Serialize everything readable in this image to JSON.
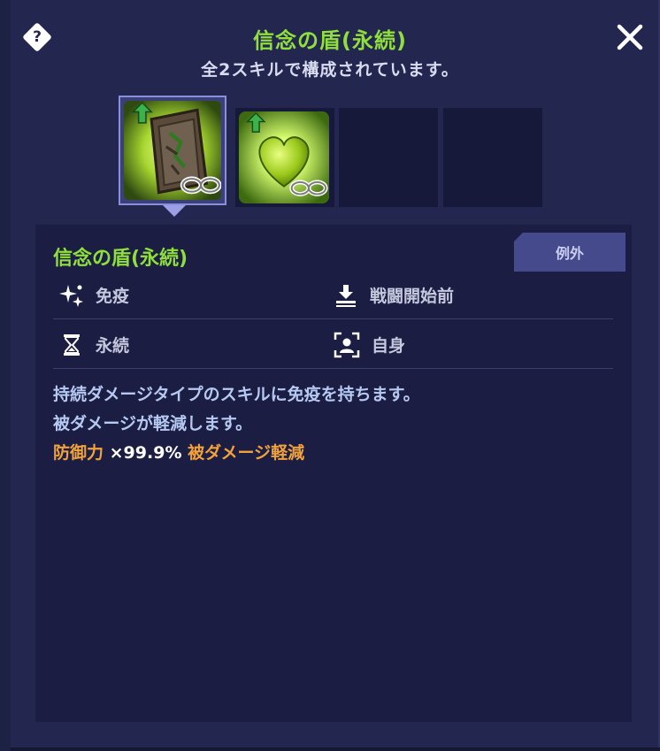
{
  "header": {
    "title": "信念の盾(永続)",
    "subtitle": "全2スキルで構成されています。",
    "help_icon": "question-diamond-icon",
    "close_icon": "close-x-icon"
  },
  "skill_slots": [
    {
      "icon": "rune-tablet-infinity-icon",
      "selected": true
    },
    {
      "icon": "green-heart-infinity-icon",
      "selected": false
    },
    {
      "icon": "empty-slot",
      "selected": false
    },
    {
      "icon": "empty-slot",
      "selected": false
    }
  ],
  "detail": {
    "name": "信念の盾(永続)",
    "tag": "例外",
    "attributes": [
      {
        "icon": "sparkle-icon",
        "label": "免疫"
      },
      {
        "icon": "download-tray-icon",
        "label": "戦闘開始前"
      },
      {
        "icon": "hourglass-icon",
        "label": "永続"
      },
      {
        "icon": "self-target-icon",
        "label": "自身"
      }
    ],
    "description": {
      "line1": "持続ダメージタイプのスキルに免疫を持ちます。",
      "line2": "被ダメージが軽減します。",
      "effect_stat": "防御力",
      "effect_value": "×99.9%",
      "effect_result": "被ダメージ軽減"
    }
  },
  "colors": {
    "accent_green": "#8fe03a",
    "highlight_orange": "#f2a23a",
    "panel_bg": "#1b1e42"
  }
}
